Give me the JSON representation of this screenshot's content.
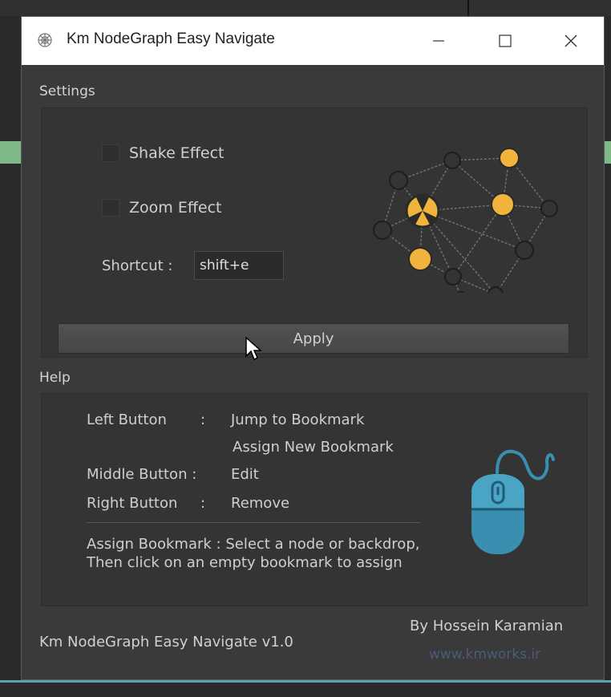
{
  "window": {
    "title": "Km NodeGraph Easy Navigate",
    "controls": {
      "minimize": "–",
      "maximize": "☐",
      "close": "✕"
    },
    "app_icon": "node-graph-icon"
  },
  "settings": {
    "section_label": "Settings",
    "shake_effect_label": "Shake Effect",
    "shake_effect_checked": false,
    "zoom_effect_label": "Zoom Effect",
    "zoom_effect_checked": false,
    "shortcut_label": "Shortcut :",
    "shortcut_value": "shift+e",
    "apply_label": "Apply",
    "illustration_icon": "node-network-icon"
  },
  "help": {
    "section_label": "Help",
    "left_button_key": "Left Button",
    "left_button_sep": ":",
    "left_button_action_1": "Jump to Bookmark",
    "left_button_action_2": "Assign New Bookmark",
    "middle_button_key": "Middle Button :",
    "middle_button_action": "Edit",
    "right_button_key": "Right Button",
    "right_button_sep": ":",
    "right_button_action": "Remove",
    "note": "Assign Bookmark : Select a node or backdrop, Then click on an empty bookmark to assign",
    "mouse_icon": "mouse-icon"
  },
  "footer": {
    "version": "Km NodeGraph Easy Navigate v1.0",
    "author": "By Hossein Karamian",
    "url": "www.kmworks.ir"
  },
  "colors": {
    "node_accent": "#f0b43c",
    "mouse_accent": "#3a8fb0",
    "window_bg": "#3a3a3a",
    "panel_bg": "#343434"
  }
}
